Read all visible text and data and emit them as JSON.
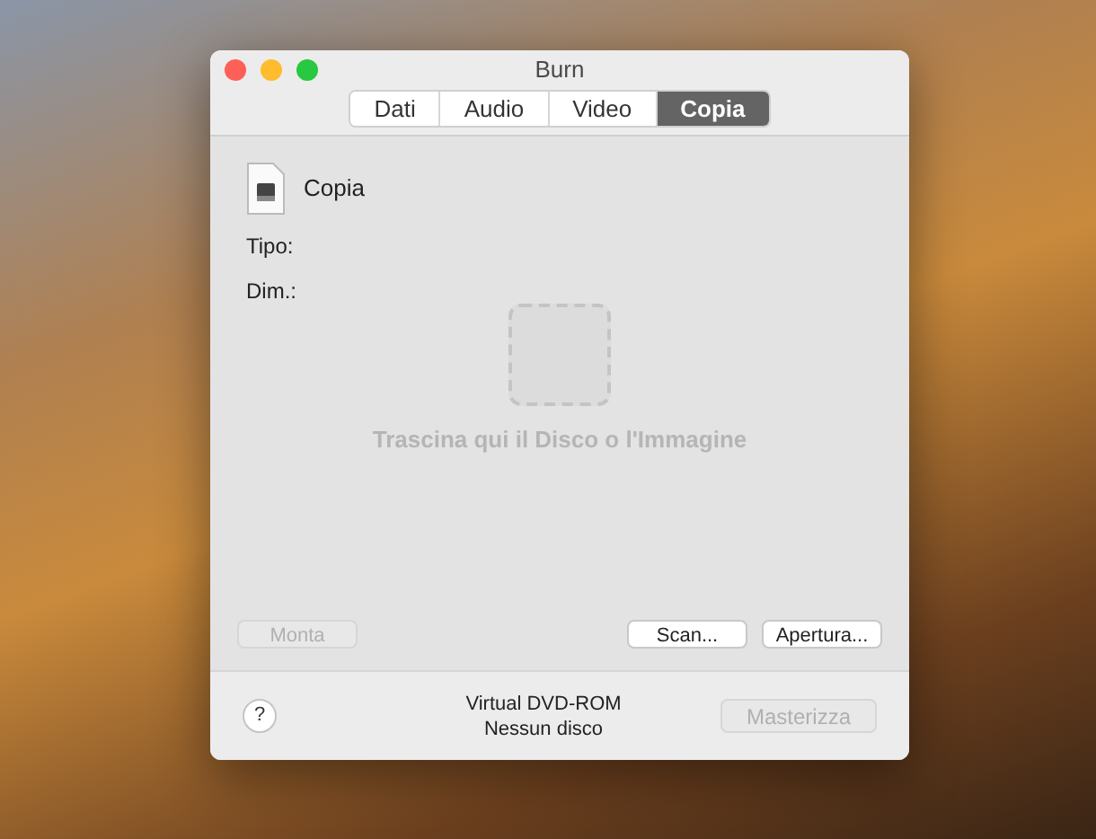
{
  "window": {
    "title": "Burn"
  },
  "tabs": [
    {
      "label": "Dati",
      "selected": false
    },
    {
      "label": "Audio",
      "selected": false
    },
    {
      "label": "Video",
      "selected": false
    },
    {
      "label": "Copia",
      "selected": true
    }
  ],
  "source": {
    "name": "Copia",
    "type_label": "Tipo:",
    "size_label": "Dim.:"
  },
  "drop_area": {
    "hint": "Trascina qui il Disco o l'Immagine"
  },
  "buttons": [
    {
      "label": "Monta",
      "disabled": true
    },
    {
      "label": "Scan...",
      "disabled": false
    },
    {
      "label": "Apertura...",
      "disabled": false
    }
  ],
  "footer": {
    "help": "?",
    "device": "Virtual DVD-ROM",
    "disc_status": "Nessun disco",
    "burn_button": {
      "label": "Masterizza",
      "disabled": true
    }
  }
}
